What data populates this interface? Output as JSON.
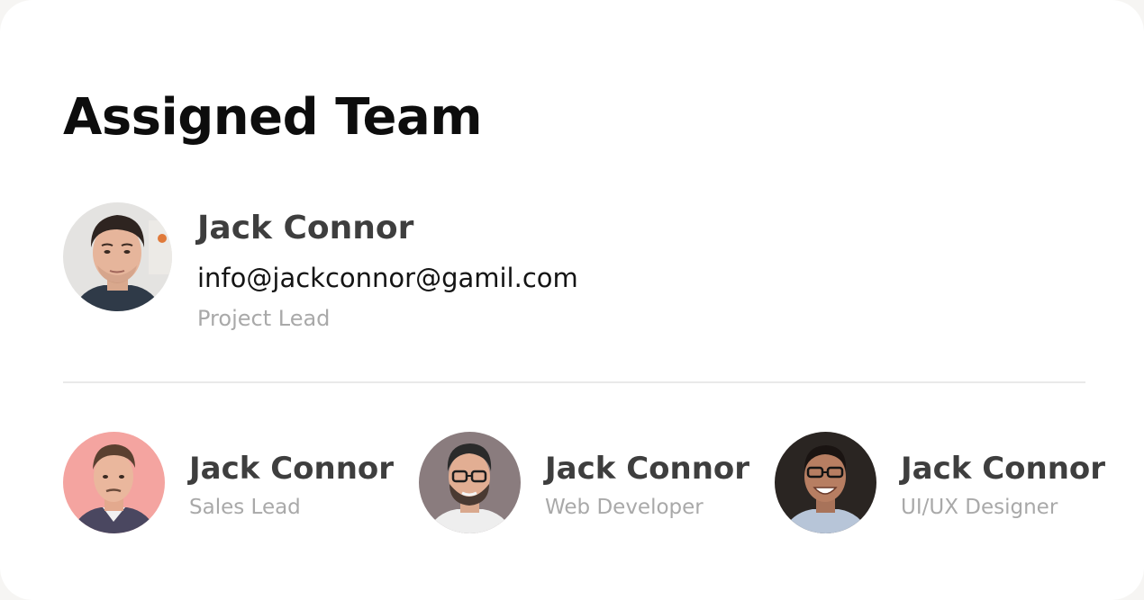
{
  "title": "Assigned Team",
  "lead": {
    "name": "Jack Connor",
    "email": "info@jackconnor@gamil.com",
    "role": "Project Lead",
    "avatar": "person-photo"
  },
  "members": [
    {
      "name": "Jack Connor",
      "role": "Sales Lead",
      "avatar": "person-photo",
      "bg": "#f4a4a0"
    },
    {
      "name": "Jack Connor",
      "role": "Web Developer",
      "avatar": "person-photo",
      "bg": "#8a7c7e"
    },
    {
      "name": "Jack Connor",
      "role": "UI/UX Designer",
      "avatar": "person-photo",
      "bg": "#2a2522"
    }
  ]
}
